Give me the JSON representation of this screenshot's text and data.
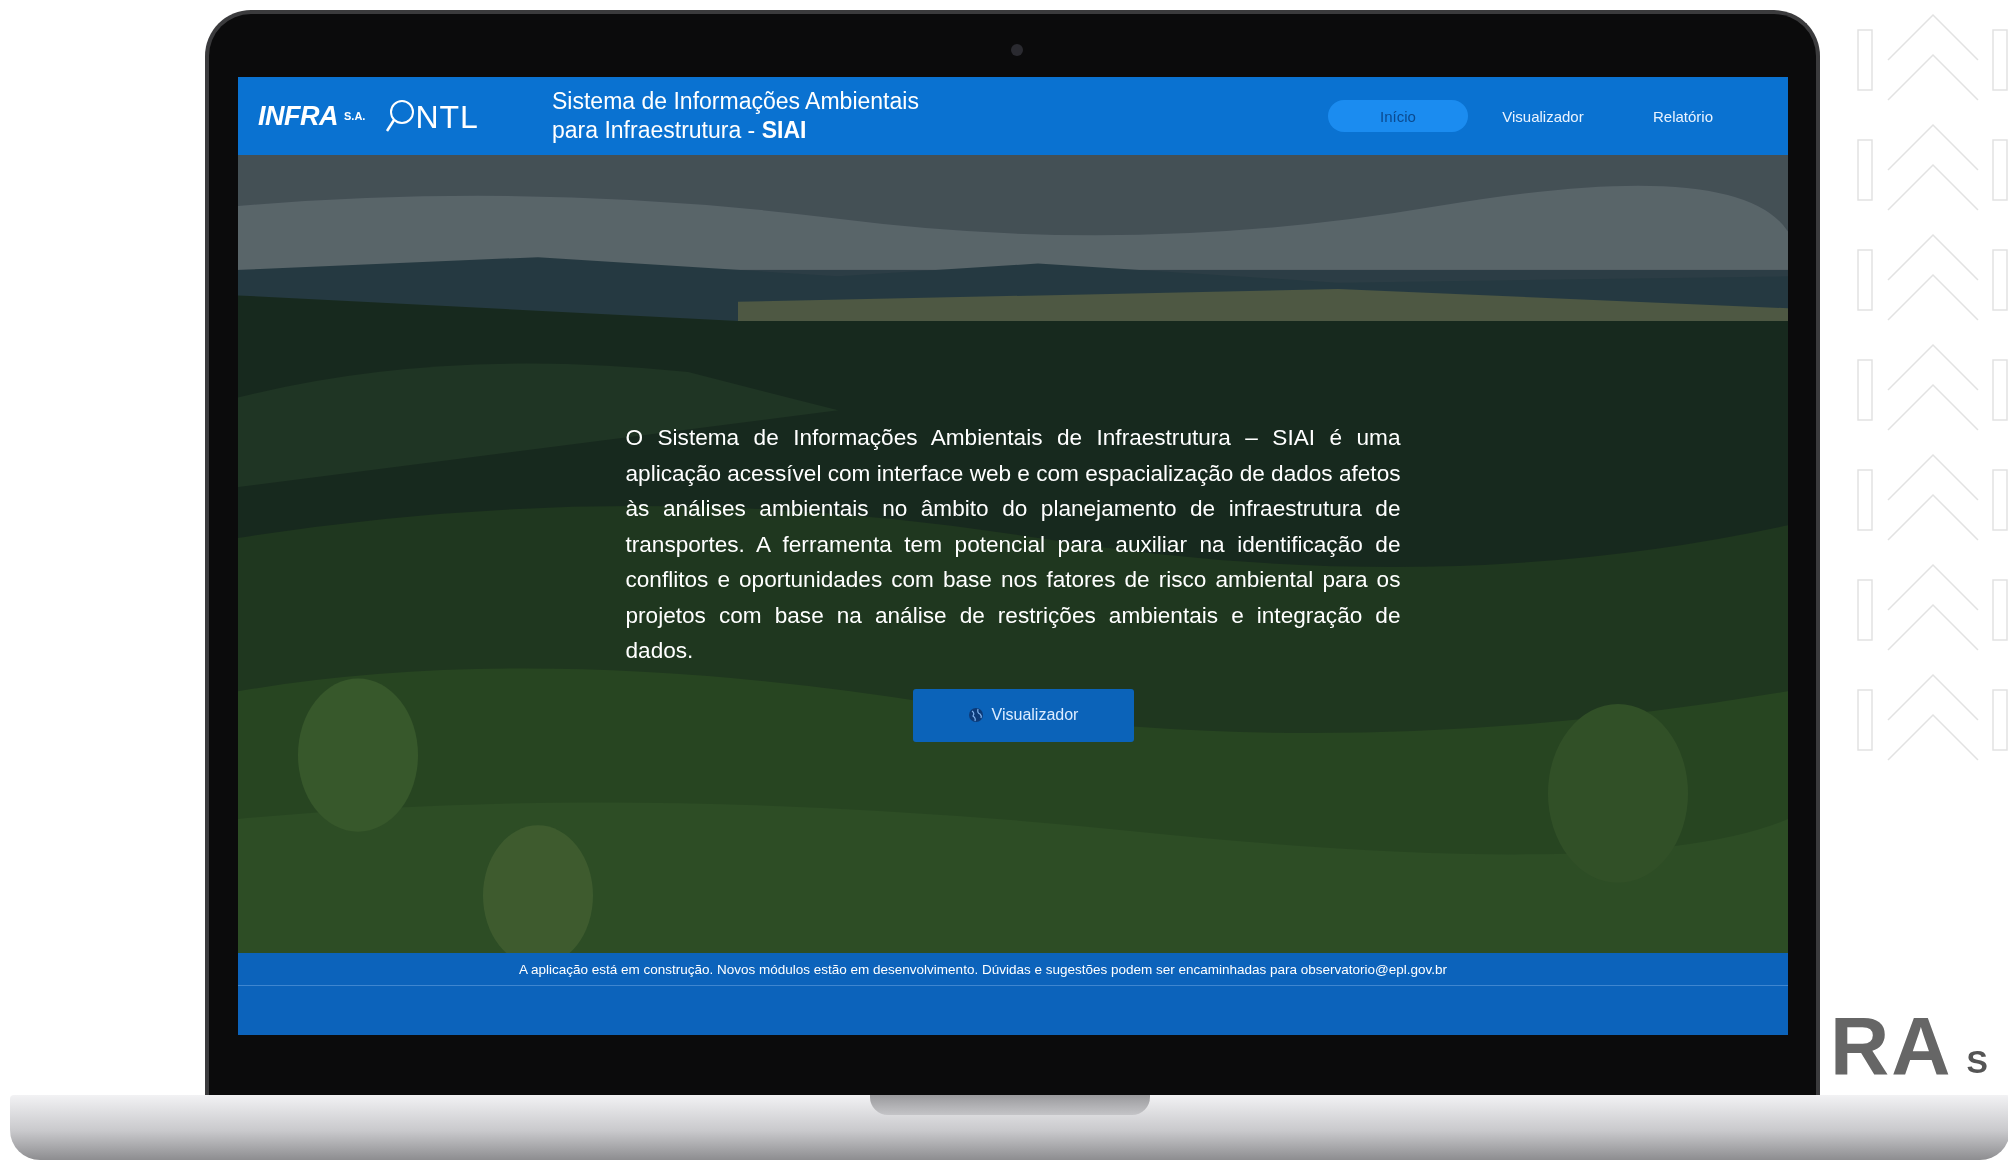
{
  "header": {
    "logos": [
      {
        "kind": "infra",
        "text": "INFRA",
        "suffix": "S.A."
      },
      {
        "kind": "ontl",
        "text": "NTL"
      }
    ],
    "title_lines": [
      "Sistema de Informações Ambientais",
      "para Infraestrutura - **SIAI**"
    ]
  },
  "nav": [
    {
      "label": "Início",
      "selected": true
    },
    {
      "label": "Visualizador",
      "selected": false
    },
    {
      "label": "Relatório",
      "selected": false
    }
  ],
  "hero": {
    "paragraph": "O Sistema de Informações Ambientais de Infraestrutura – SIAI é uma aplicação acessível com interface web e com espacialização de dados afetos às análises ambientais no âmbito do planejamento de infraestrutura de transportes. A ferramenta tem potencial para auxiliar na identificação de conflitos e oportunidades com base nos fatores de risco ambiental para os projetos com base na análise de restrições ambientais e integração de dados.",
    "button": "Visualizador"
  },
  "footer": {
    "notice": "A aplicação está em construção. Novos módulos estão em desenvolvimento. Dúvidas e sugestões podem ser encaminhadas para observatorio@epl.gov.br"
  },
  "backdrop_logo": {
    "text": "RA",
    "suffix": "S"
  }
}
